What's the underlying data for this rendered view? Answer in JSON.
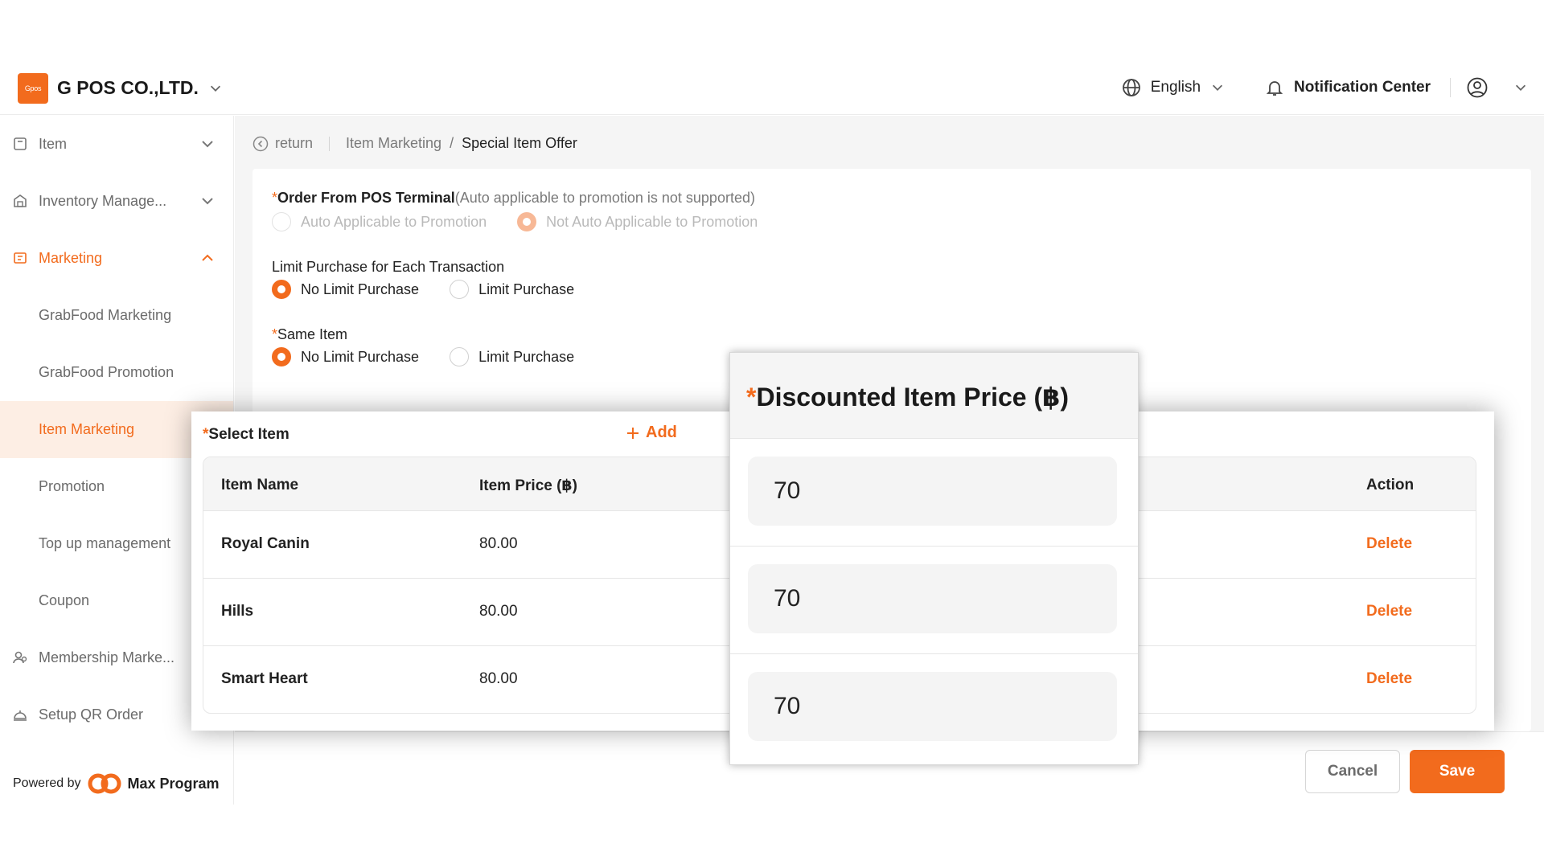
{
  "header": {
    "logo_text": "Gpos",
    "company": "G POS CO.,LTD.",
    "language": "English",
    "notification": "Notification Center"
  },
  "sidebar": {
    "items": [
      {
        "label": "Item",
        "icon": "item-icon"
      },
      {
        "label": "Inventory Manage...",
        "icon": "inventory-icon"
      },
      {
        "label": "Marketing",
        "icon": "marketing-icon"
      },
      {
        "label": "GrabFood Marketing"
      },
      {
        "label": "GrabFood Promotion"
      },
      {
        "label": "Item Marketing"
      },
      {
        "label": "Promotion"
      },
      {
        "label": "Top up management"
      },
      {
        "label": "Coupon"
      },
      {
        "label": "Membership Marke...",
        "icon": "membership-icon"
      },
      {
        "label": "Setup QR Order",
        "icon": "qr-order-icon"
      }
    ],
    "powered_by": "Powered by",
    "brand": "Max Program"
  },
  "breadcrumb": {
    "return": "return",
    "parent": "Item Marketing",
    "separator": "/",
    "current": "Special Item Offer"
  },
  "form": {
    "order_from_pos": {
      "label": "Order From POS Terminal",
      "note": "(Auto applicable to promotion is not supported)",
      "options": [
        "Auto Applicable to Promotion",
        "Not Auto Applicable to Promotion"
      ]
    },
    "limit_purchase": {
      "label": "Limit Purchase for Each Transaction",
      "options": [
        "No Limit Purchase",
        "Limit Purchase"
      ]
    },
    "same_item": {
      "label": "Same Item",
      "options": [
        "No Limit Purchase",
        "Limit Purchase"
      ]
    }
  },
  "select_item": {
    "title": "Select Item",
    "add_label": "Add",
    "columns": {
      "name": "Item Name",
      "price": "Item Price (฿)",
      "discounted": "Discounted Item Price (฿)",
      "action": "Action"
    },
    "rows": [
      {
        "name": "Royal Canin",
        "price": "80.00",
        "discounted": "70",
        "action": "Delete"
      },
      {
        "name": "Hills",
        "price": "80.00",
        "discounted": "70",
        "action": "Delete"
      },
      {
        "name": "Smart Heart",
        "price": "80.00",
        "discounted": "70",
        "action": "Delete"
      }
    ]
  },
  "footer": {
    "cancel": "Cancel",
    "save": "Save"
  },
  "colors": {
    "accent": "#f26b1d",
    "selected_bg": "#fdeee4"
  }
}
